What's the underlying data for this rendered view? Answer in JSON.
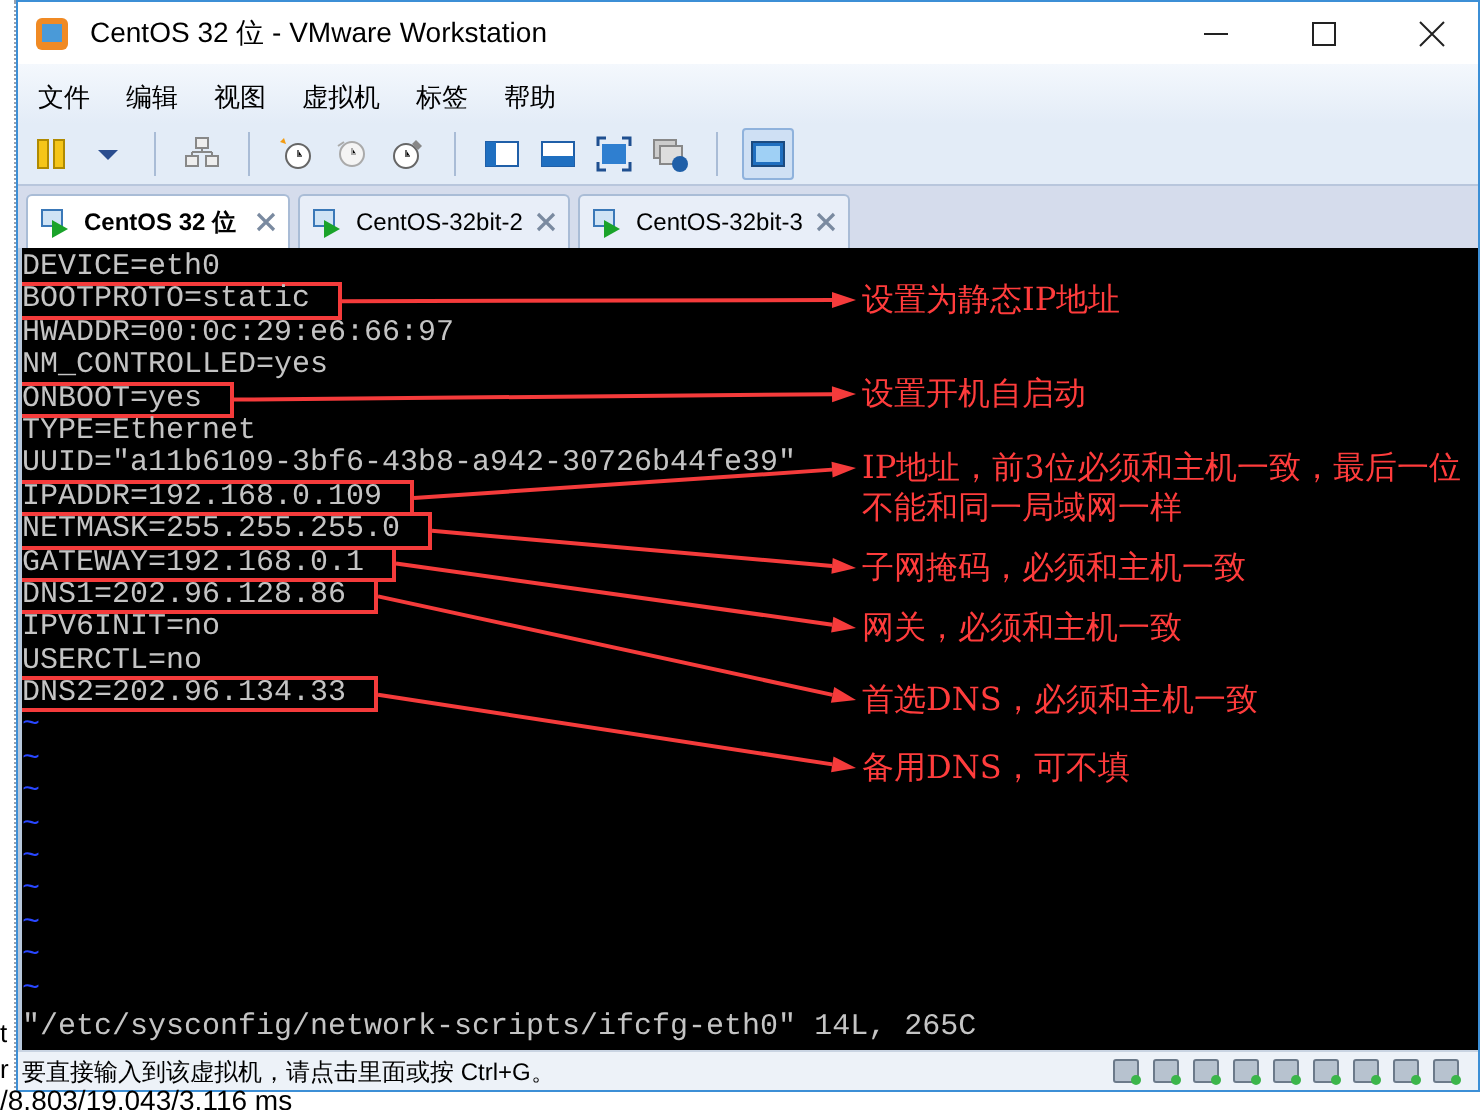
{
  "window": {
    "title": "CentOS 32 位 - VMware Workstation"
  },
  "menu": [
    "文件",
    "编辑",
    "视图",
    "虚拟机",
    "标签",
    "帮助"
  ],
  "toolbar": [
    {
      "kind": "pause",
      "selected": false
    },
    {
      "kind": "dropdown",
      "selected": false
    },
    {
      "kind": "network",
      "selected": false
    },
    {
      "kind": "snapshot",
      "selected": false
    },
    {
      "kind": "revert",
      "selected": false
    },
    {
      "kind": "manage",
      "selected": false
    },
    {
      "kind": "console",
      "selected": false
    },
    {
      "kind": "tabbar",
      "selected": false
    },
    {
      "kind": "fullscreen",
      "selected": false
    },
    {
      "kind": "unity",
      "selected": false
    },
    {
      "kind": "view",
      "selected": true
    }
  ],
  "tabs": [
    {
      "label": "CentOS 32 位",
      "selected": true
    },
    {
      "label": "CentOS-32bit-2",
      "selected": false
    },
    {
      "label": "CentOS-32bit-3",
      "selected": false
    }
  ],
  "terminal": {
    "lines": [
      {
        "text": "DEVICE=eth0"
      },
      {
        "text": "BOOTPROTO=static",
        "note": "设置为静态IP地址"
      },
      {
        "text": "HWADDR=00:0c:29:e6:66:97"
      },
      {
        "text": "NM_CONTROLLED=yes"
      },
      {
        "text": "ONBOOT=yes",
        "note": "设置开机自启动"
      },
      {
        "text": "TYPE=Ethernet"
      },
      {
        "text": "UUID=\"a11b6109-3bf6-43b8-a942-30726b44fe39\""
      },
      {
        "text": "IPADDR=192.168.0.109",
        "note": "IP地址，前3位必须和主机一致，最后一位不能和同一局域网一样"
      },
      {
        "text": "NETMASK=255.255.255.0",
        "note": "子网掩码，必须和主机一致"
      },
      {
        "text": "GATEWAY=192.168.0.1",
        "note": "网关，必须和主机一致"
      },
      {
        "text": "DNS1=202.96.128.86",
        "note": "首选DNS，必须和主机一致"
      },
      {
        "text": "IPV6INIT=no"
      },
      {
        "text": "USERCTL=no"
      },
      {
        "text": "DNS2=202.96.134.33",
        "note": "备用DNS，可不填"
      }
    ],
    "tildes": [
      "~",
      "~",
      "~",
      "~",
      "~",
      "~",
      "~",
      "~",
      "~"
    ],
    "status_line": "\"/etc/sysconfig/network-scripts/ifcfg-eth0\" 14L, 265C"
  },
  "status_bar": {
    "message": "要直接输入到该虚拟机，请点击里面或按 Ctrl+G。"
  },
  "background_window": {
    "side_text": [
      "t",
      "r"
    ],
    "bottom_text": "/8.803/19.043/3.116 ms"
  }
}
